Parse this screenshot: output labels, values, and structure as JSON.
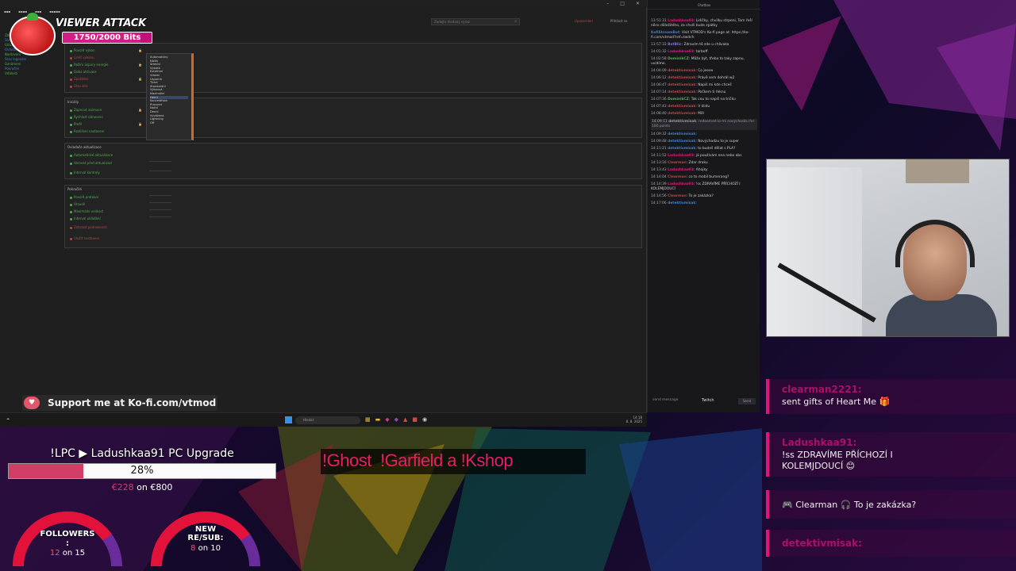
{
  "viewer_attack": {
    "title": "VIEWER ATTACK",
    "progress_text": "1750/2000 Bits",
    "progress_fraction": 0.875
  },
  "kofi": {
    "text": "Support me at Ko-fi.com/vtmod"
  },
  "desktop": {
    "search_placeholder": "Zadejte hledaný výraz",
    "side_tree": [
      "Základní",
      "Stav",
      "Uživatelé",
      "Ovládání",
      "Nastavení",
      "Stav logování",
      "Oznámení",
      "Pokročilé",
      "Události"
    ],
    "panels": [
      {
        "title": "",
        "rows": [
          "Povolit výkon",
          "Limit výkonu",
          "Režim úspory energie",
          "Doba aktivace",
          "Zpoždění",
          "Stav sítě"
        ]
      },
      {
        "title": "Iniciály",
        "rows": [
          "Zapnout animace",
          "Rychlost obnovení",
          "Profil",
          "Rozlišení nastavení"
        ]
      },
      {
        "title": "Ovladače aktualizace",
        "rows": [
          "Automatické aktualizace",
          "Varovat před aktualizací",
          "Interval kontroly"
        ]
      },
      {
        "title": "Pokročilé",
        "rows": [
          "Povolit protokol",
          "Úroveň",
          "Maximální velikost",
          "Interval ukládání",
          "Zobrazit podrobnosti",
          "Uložit nastavení"
        ]
      }
    ],
    "dropdown_options": [
      "Automaticky",
      "Nízká",
      "Střední",
      "Vysoká",
      "Extrémní",
      "Vlastní",
      "Úsporná",
      "Tichá",
      "Standardní",
      "Výkonná",
      "Maximální",
      "Herní",
      "Kancelářská",
      "Pracovní",
      "Noční",
      "Denní",
      "Vyvážená",
      "Lightning",
      "Off"
    ],
    "top_links": [
      "Upozornění",
      "Přihlásit se"
    ],
    "taskbar": {
      "search": "Hledat",
      "tray_time": "14:18",
      "tray_date": "8. 8. 2025"
    }
  },
  "chat": {
    "header": "Chatbox",
    "messages": [
      {
        "time": "13:51:31",
        "user": "Ladushkaa91",
        "text": "Lidičky, chvilku strpení, Tom řeší něco důležitého, za chvíli bude zpátky",
        "color": "#e0157a"
      },
      {
        "time": "",
        "user": "KofiStreamBot",
        "text": "Visit VTMOD's Ko-fi page at: https://ko-fi.com/vtmod?ref=twitch",
        "color": "#3f7fc7"
      },
      {
        "time": "13:57:33",
        "user": "BotBlic",
        "text": "Zdravím tě zde u chlívaka",
        "color": "#8a6adf"
      },
      {
        "time": "14:01:32",
        "user": "Ladushkaa91",
        "text": "tarboff",
        "color": "#e0157a"
      },
      {
        "time": "14:02:58",
        "user": "DominikCZ",
        "text": "Může být, třeba to taky zapnu, uvidíme.",
        "color": "#55aa55"
      },
      {
        "time": "14:04:09",
        "user": "detektivmisak",
        "text": "Co jeeee",
        "color": "#b04a4a"
      },
      {
        "time": "14:06:12",
        "user": "detektivmisak",
        "text": "Právě sem dohrál w2",
        "color": "#b04a4a"
      },
      {
        "time": "14:06:47",
        "user": "detektivmisak",
        "text": "Napiš mi kde chceš",
        "color": "#b04a4a"
      },
      {
        "time": "14:07:14",
        "user": "detektivmisak",
        "text": "Počkem ti řeknu",
        "color": "#b04a4a"
      },
      {
        "time": "14:07:36",
        "user": "DominikCZ",
        "text": "Tak cou to napiš na tričku",
        "color": "#55aa55"
      },
      {
        "time": "14:07:43",
        "user": "detektivmisak",
        "text": "V klidu",
        "color": "#b04a4a"
      },
      {
        "time": "14:08:40",
        "user": "detektivmisak",
        "text": "Měl",
        "color": "#b04a4a"
      },
      {
        "time": "14:09:11",
        "user": "detektivmisak",
        "text": "redeemed lo-mi novýchodzu for 100 points",
        "color": "#999999",
        "highlight": true
      },
      {
        "time": "14:09:32",
        "user": "detektivmisak",
        "text": "",
        "color": "#3f7fc7"
      },
      {
        "time": "14:09:48",
        "user": "detektivmisak",
        "text": "Novýchodzu to je super",
        "color": "#3f7fc7"
      },
      {
        "time": "14:11:21",
        "user": "detektivmisak",
        "text": "to budeš dělat s PLA?",
        "color": "#3f7fc7"
      },
      {
        "time": "14:11:52",
        "user": "Ladushkaa91",
        "text": "já používám ena nebo abs",
        "color": "#e0157a"
      },
      {
        "time": "14:13:16",
        "user": "Clearman",
        "text": "Zdar draku",
        "color": "#b04a4a"
      },
      {
        "time": "14:13:43",
        "user": "Ladushkaa91",
        "text": "Ahojky",
        "color": "#e0157a"
      },
      {
        "time": "14:14:04",
        "user": "Clearman",
        "text": "co to mobil bumerang?",
        "color": "#b04a4a"
      },
      {
        "time": "14:14:39",
        "user": "Ladushkaa91",
        "text": "!ss ZDRAVÍME PŘÍCHOZÍ I KOLEMJDOUCÍ",
        "color": "#e0157a"
      },
      {
        "time": "14:14:56",
        "user": "Clearman",
        "text": "To je zakázka?",
        "color": "#b04a4a"
      },
      {
        "time": "14:17:06",
        "user": "detektivmisak",
        "text": "",
        "color": "#3f7fc7"
      }
    ],
    "input_placeholder": "send message",
    "platform": "Twitch",
    "send_label": "Send"
  },
  "feed": [
    {
      "user": "clearman2221:",
      "text": "sent gifts of Heart Me 🎁"
    },
    {
      "user": "Ladushkaa91:",
      "text": "!ss ZDRAVÍME PŘÍCHOZÍ I",
      "text2": "KOLEMJDOUCÍ 😊"
    },
    {
      "user": "",
      "text": "🎮 Clearman 🎧 To je zakázka?"
    },
    {
      "user": "detektivmisak:",
      "text": ""
    }
  ],
  "goal": {
    "title": "!LPC ▶ Ladushkaa91 PC Upgrade",
    "percent_text": "28%",
    "percent": 0.28,
    "current": "€228",
    "target_text": " on €800"
  },
  "followers": {
    "label1": "FOLLOWERS",
    "label2": ":",
    "current": "12",
    "rest": " on 15",
    "fraction": 0.8
  },
  "subs": {
    "label1": "NEW",
    "label2": "RE/SUB:",
    "current": "8",
    "rest": " on 10",
    "fraction": 0.8
  },
  "commands": {
    "text": "!Ghost  !Garfield a !Kshop"
  },
  "colors": {
    "accent": "#e0157a",
    "goal_fill": "#d23d66",
    "gauge_red": "#e3123a",
    "gauge_purple": "#6a2c9a"
  }
}
